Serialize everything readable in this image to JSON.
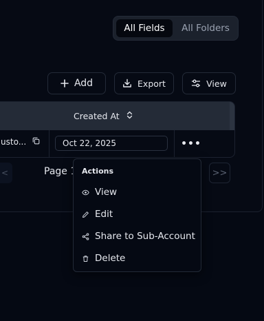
{
  "view_toggle": {
    "active": "All Fields",
    "inactive": "All Folders"
  },
  "toolbar": {
    "add_label": "Add",
    "export_label": "Export",
    "view_label": "View"
  },
  "table": {
    "columns": [
      "Created At"
    ],
    "rows": [
      {
        "name": "usto...",
        "created_at": "Oct 22, 2025",
        "more": "•••"
      }
    ]
  },
  "pagination": {
    "label": "Page 1",
    "prev_glyph": "<",
    "last_glyph": ">>"
  },
  "context_menu": {
    "title": "Actions",
    "items": [
      {
        "label": "View",
        "icon": "eye-icon"
      },
      {
        "label": "Edit",
        "icon": "pencil-icon"
      },
      {
        "label": "Share to Sub-Account",
        "icon": "share-icon"
      },
      {
        "label": "Delete",
        "icon": "trash-icon"
      }
    ]
  },
  "colors": {
    "background": "#050913",
    "header": "#242b37",
    "border": "#232a37",
    "text": "#e6e8ee",
    "muted": "#9aa2b1"
  }
}
